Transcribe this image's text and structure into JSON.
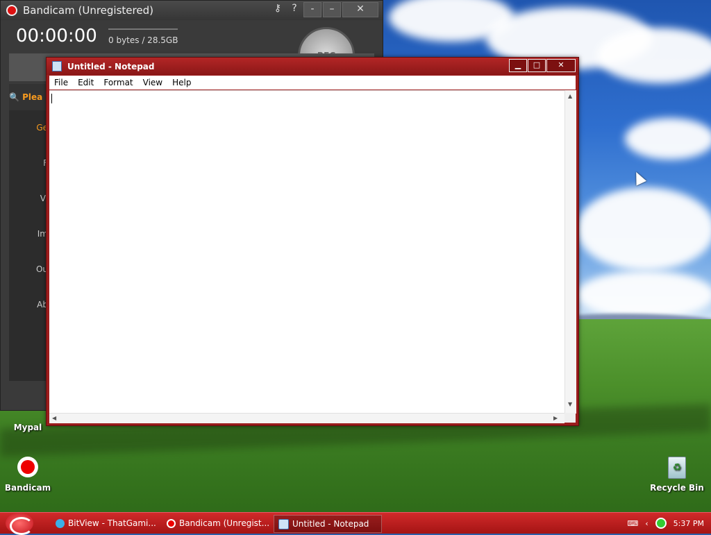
{
  "bandicam": {
    "title": "Bandicam (Unregistered)",
    "timer": "00:00:00",
    "size": "0 bytes / 28.5GB",
    "rec_label": "REC",
    "search_placeholder": "Plea",
    "sidebar": [
      "Ge",
      "F",
      "Vi",
      "Im",
      "Ou",
      "Ab"
    ]
  },
  "notepad": {
    "title": "Untitled - Notepad",
    "menu": [
      "File",
      "Edit",
      "Format",
      "View",
      "Help"
    ],
    "text": ""
  },
  "desktop_icons": [
    {
      "label": "Mypal"
    },
    {
      "label": "Bandicam"
    },
    {
      "label": "Recycle Bin"
    }
  ],
  "taskbar": {
    "tasks": [
      {
        "label": "BitView - ThatGami...",
        "icon": "globe-icon"
      },
      {
        "label": "Bandicam (Unregist...",
        "icon": "record-icon"
      },
      {
        "label": "Untitled - Notepad",
        "icon": "notepad-icon"
      }
    ],
    "clock": "5:37 PM"
  }
}
